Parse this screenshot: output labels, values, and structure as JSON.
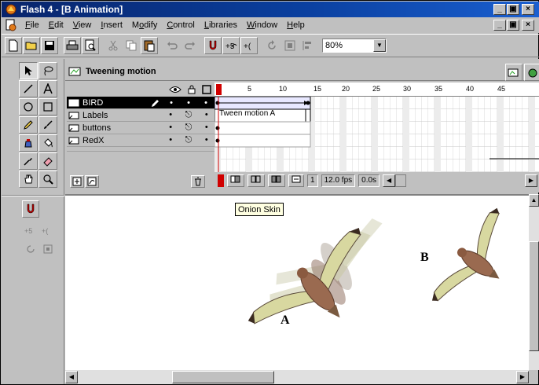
{
  "window": {
    "title": "Flash 4 - [B Animation]"
  },
  "menu": {
    "items": [
      {
        "pre": "",
        "u": "F",
        "post": "ile"
      },
      {
        "pre": "",
        "u": "E",
        "post": "dit"
      },
      {
        "pre": "",
        "u": "V",
        "post": "iew"
      },
      {
        "pre": "",
        "u": "I",
        "post": "nsert"
      },
      {
        "pre": "M",
        "u": "o",
        "post": "dify"
      },
      {
        "pre": "",
        "u": "C",
        "post": "ontrol"
      },
      {
        "pre": "",
        "u": "L",
        "post": "ibraries"
      },
      {
        "pre": "",
        "u": "W",
        "post": "indow"
      },
      {
        "pre": "",
        "u": "H",
        "post": "elp"
      }
    ]
  },
  "toolbar": {
    "zoom_value": "80%"
  },
  "timeline": {
    "scene_name": "Tweening motion",
    "ruler_ticks": [
      "5",
      "10",
      "15",
      "20",
      "25",
      "30",
      "35",
      "40",
      "45"
    ],
    "layers": [
      {
        "name": "BIRD",
        "active": true
      },
      {
        "name": "Labels",
        "active": false
      },
      {
        "name": "buttons",
        "active": false
      },
      {
        "name": "RedX",
        "active": false
      }
    ],
    "tween_label": "Tween motion A",
    "current_frame": "1",
    "frame_rate": "12.0 fps",
    "elapsed_time": "0.0s"
  },
  "stage": {
    "tooltip": "Onion Skin",
    "label_a": "A",
    "label_b": "B"
  },
  "colors": {
    "title_bar": "#08246b",
    "chrome": "#c0c0c0",
    "playhead": "#d00000",
    "layer_selected": "#000000",
    "tooltip_bg": "#ffffe1"
  }
}
